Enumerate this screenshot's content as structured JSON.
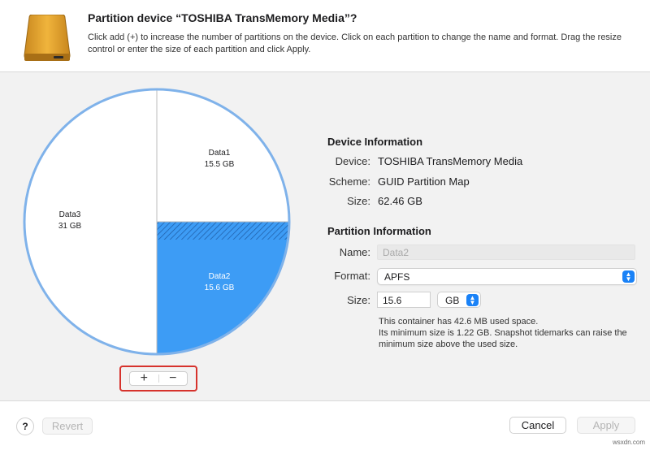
{
  "dialog": {
    "title": "Partition device “TOSHIBA TransMemory Media”?",
    "subtitle": "Click add (+) to increase the number of partitions on the device. Click on each partition to change the name and format. Drag the resize control or enter the size of each partition and click Apply."
  },
  "partitions": [
    {
      "name": "Data1",
      "size": "15.5 GB",
      "selected": false
    },
    {
      "name": "Data2",
      "size": "15.6 GB",
      "selected": true
    },
    {
      "name": "Data3",
      "size": "31 GB",
      "selected": false
    }
  ],
  "controls": {
    "add_label": "+",
    "remove_label": "−"
  },
  "device_info": {
    "heading": "Device Information",
    "device_label": "Device:",
    "device_value": "TOSHIBA TransMemory Media",
    "scheme_label": "Scheme:",
    "scheme_value": "GUID Partition Map",
    "size_label": "Size:",
    "size_value": "62.46 GB"
  },
  "partition_info": {
    "heading": "Partition Information",
    "name_label": "Name:",
    "name_placeholder": "Data2",
    "format_label": "Format:",
    "format_value": "APFS",
    "size_label": "Size:",
    "size_value": "15.6",
    "size_unit": "GB",
    "info_text": "This container has 42.6 MB used space.\nIts minimum size is 1.22 GB. Snapshot tidemarks can raise the minimum size above the used size."
  },
  "footer": {
    "help_label": "?",
    "revert_label": "Revert",
    "cancel_label": "Cancel",
    "apply_label": "Apply"
  },
  "watermark": "wsxdn.com",
  "colors": {
    "accent": "#1a82f7",
    "selected_partition": "#3d9cf5",
    "highlight_border": "#d6322c"
  }
}
